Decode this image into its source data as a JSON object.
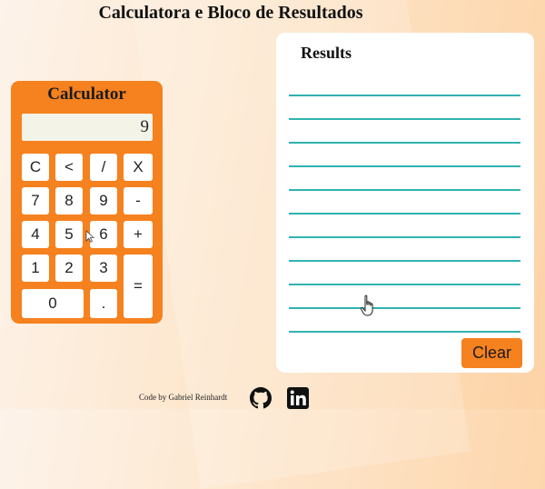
{
  "page": {
    "title": "Calculatora e Bloco de Resultados"
  },
  "calculator": {
    "title": "Calculator",
    "display_value": "9",
    "keys": {
      "clear": "C",
      "backspace": "<",
      "divide": "/",
      "multiply": "X",
      "seven": "7",
      "eight": "8",
      "nine": "9",
      "minus": "-",
      "four": "4",
      "five": "5",
      "six": "6",
      "plus": "+",
      "one": "1",
      "two": "2",
      "three": "3",
      "equals": "=",
      "zero": "0",
      "decimal": "."
    }
  },
  "results": {
    "title": "Results",
    "entries": [
      "",
      "",
      "",
      "",
      "",
      "",
      "",
      "",
      "",
      "",
      ""
    ],
    "clear_label": "Clear"
  },
  "footer": {
    "credit": "Code by Gabriel Reinhardt",
    "icons": [
      "github-icon",
      "linkedin-icon"
    ]
  },
  "colors": {
    "accent": "#f5811f",
    "line": "#2fb3b0",
    "panel": "#ffffff"
  }
}
